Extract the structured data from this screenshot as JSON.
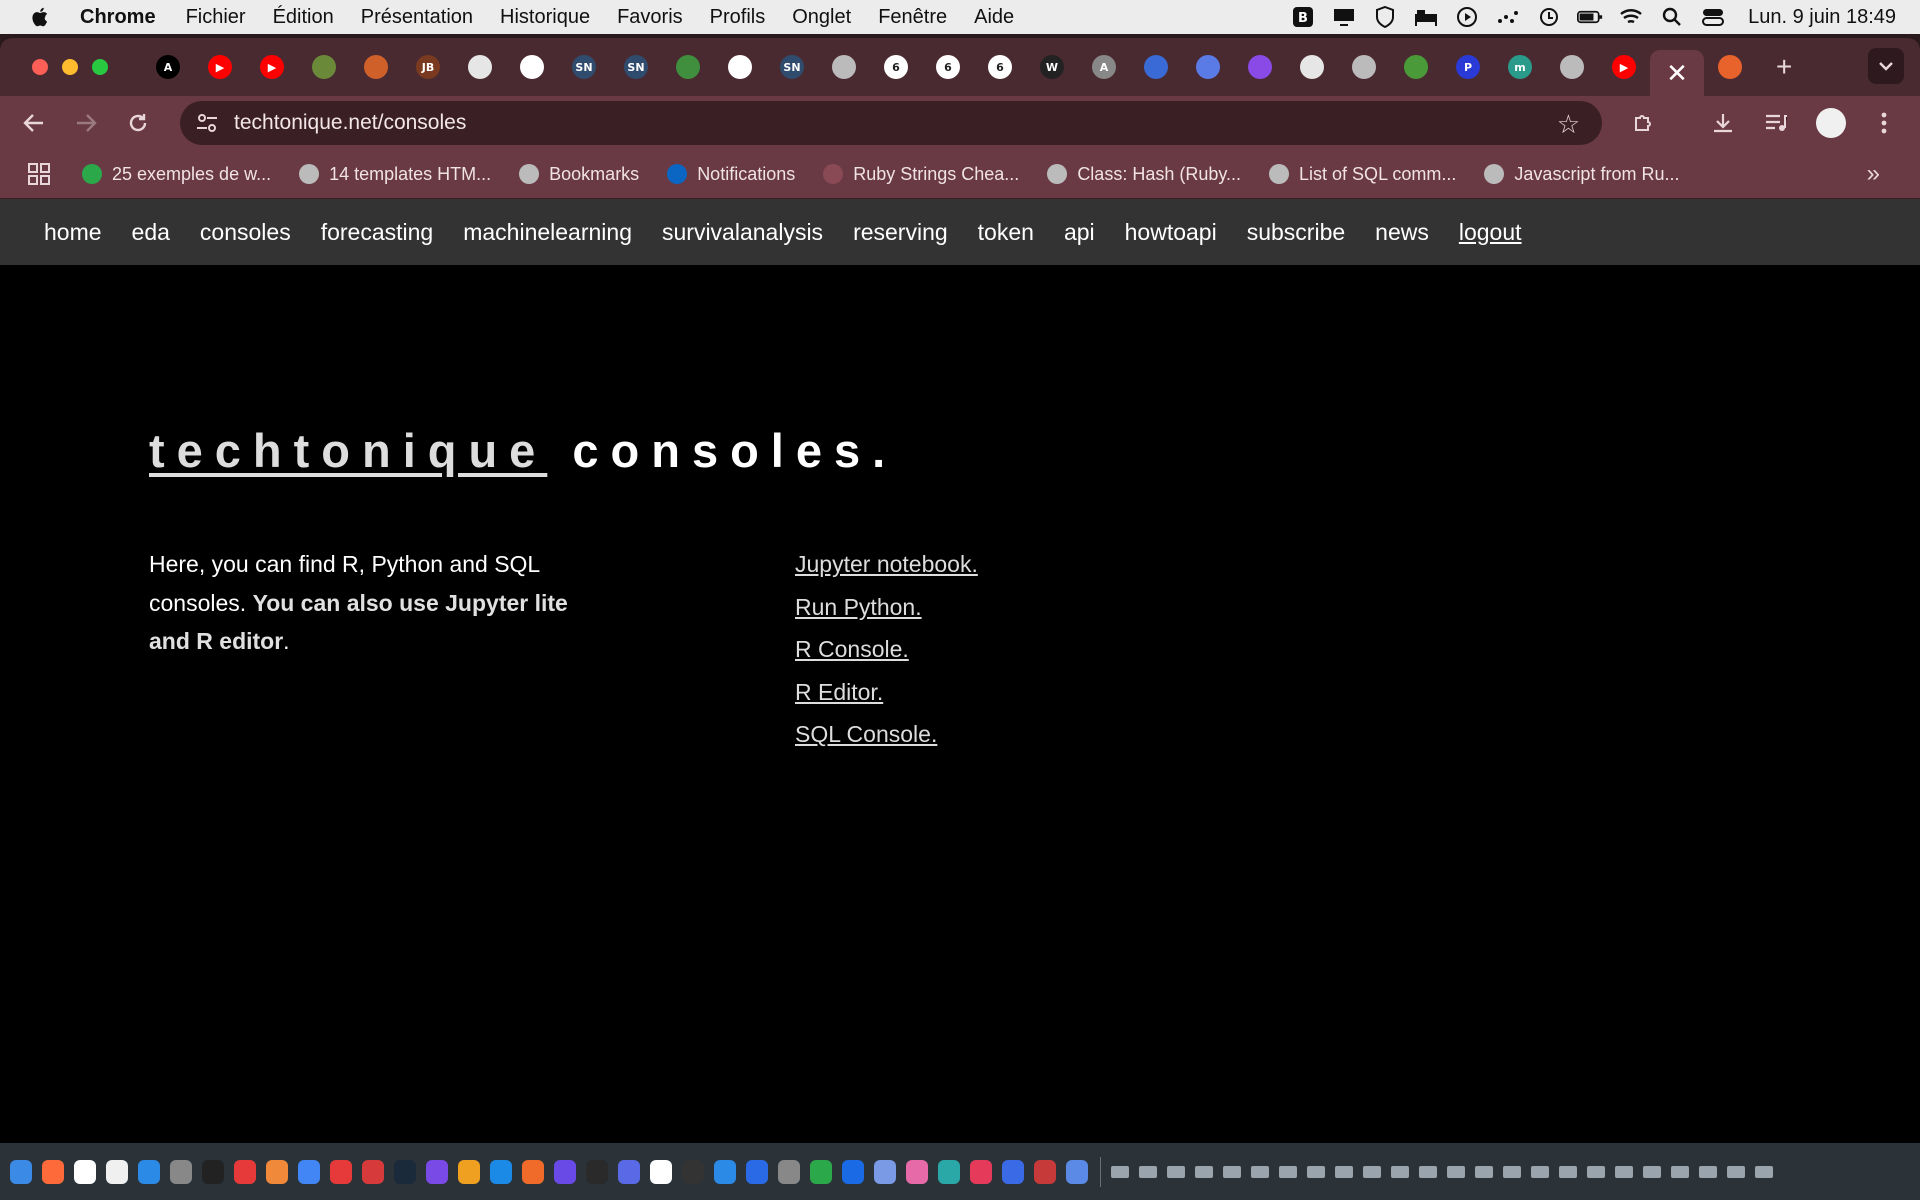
{
  "menubar": {
    "app": "Chrome",
    "items": [
      "Fichier",
      "Édition",
      "Présentation",
      "Historique",
      "Favoris",
      "Profils",
      "Onglet",
      "Fenêtre",
      "Aide"
    ],
    "clock": "Lun. 9 juin  18:49"
  },
  "tabs": {
    "favicons": [
      {
        "letter": "A",
        "color": "#000000"
      },
      {
        "letter": "▶",
        "color": "#ff0000"
      },
      {
        "letter": "▶",
        "color": "#ff0000"
      },
      {
        "letter": "",
        "color": "#6a8a3a"
      },
      {
        "letter": "",
        "color": "#d0602a"
      },
      {
        "letter": "JB",
        "color": "#7a3a20"
      },
      {
        "letter": "",
        "color": "#e6e6e6"
      },
      {
        "letter": "",
        "color": "#ffffff"
      },
      {
        "letter": "SN",
        "color": "#2f4b6e"
      },
      {
        "letter": "SN",
        "color": "#2f4b6e"
      },
      {
        "letter": "",
        "color": "#3f8f3f"
      },
      {
        "letter": "",
        "color": "#ffffff"
      },
      {
        "letter": "SN",
        "color": "#2f4b6e"
      },
      {
        "letter": "",
        "color": "#bbbbbb"
      },
      {
        "letter": "6",
        "color": "#ffffff"
      },
      {
        "letter": "6",
        "color": "#ffffff"
      },
      {
        "letter": "6",
        "color": "#ffffff"
      },
      {
        "letter": "W",
        "color": "#222222"
      },
      {
        "letter": "A",
        "color": "#888888"
      },
      {
        "letter": "",
        "color": "#3a6ad6"
      },
      {
        "letter": "",
        "color": "#5a7ae6"
      },
      {
        "letter": "",
        "color": "#8a4ae6"
      },
      {
        "letter": "",
        "color": "#e6e6e6"
      },
      {
        "letter": "",
        "color": "#bbbbbb"
      },
      {
        "letter": "",
        "color": "#4a9a3a"
      },
      {
        "letter": "P",
        "color": "#2a3ad6"
      },
      {
        "letter": "m",
        "color": "#2a9a8a"
      },
      {
        "letter": "",
        "color": "#bbbbbb"
      },
      {
        "letter": "▶",
        "color": "#ff0000"
      }
    ],
    "active_close": "✕",
    "after_active": {
      "letter": "",
      "color": "#e8632b"
    },
    "new_tab": "+"
  },
  "toolbar": {
    "url": "techtonique.net/consoles"
  },
  "bookmarks": [
    {
      "label": "25 exemples de w...",
      "color": "#2aa84a"
    },
    {
      "label": "14 templates HTM...",
      "color": "#bbbbbb"
    },
    {
      "label": "Bookmarks",
      "color": "#bbbbbb"
    },
    {
      "label": "Notifications",
      "color": "#0a66c2"
    },
    {
      "label": "Ruby Strings Chea...",
      "color": "#8a4a55"
    },
    {
      "label": "Class: Hash (Ruby...",
      "color": "#bbbbbb"
    },
    {
      "label": "List of SQL comm...",
      "color": "#bbbbbb"
    },
    {
      "label": "Javascript from Ru...",
      "color": "#bbbbbb"
    }
  ],
  "site": {
    "nav": [
      "home",
      "eda",
      "consoles",
      "forecasting",
      "machinelearning",
      "survivalanalysis",
      "reserving",
      "token",
      "api",
      "howtoapi",
      "subscribe",
      "news"
    ],
    "logout": "logout",
    "title_brand": "techtonique",
    "title_rest": " consoles.",
    "intro_plain": "Here, you can find R, Python and SQL consoles.",
    "intro_bold": "You can also use Jupyter lite and R editor",
    "intro_end": ".",
    "links": [
      "Jupyter notebook.",
      "Run Python.",
      "R Console.",
      "R Editor.",
      "SQL Console."
    ]
  },
  "dock": {
    "colors": [
      "#3a8ae6",
      "#ff6a3a",
      "#ffffff",
      "#f0f0f0",
      "#2a8ae6",
      "#888888",
      "#222222",
      "#e63a3a",
      "#f08a3a",
      "#4285f4",
      "#e63a3a",
      "#d63a3a",
      "#1a2a3a",
      "#7a4ae6",
      "#f0a020",
      "#1a8ae6",
      "#f06a2a",
      "#6a4ae6",
      "#2a2a2a",
      "#5a6ae6",
      "#ffffff",
      "#333333",
      "#2a8ae6",
      "#2a6ae6",
      "#888888",
      "#2aa84a",
      "#1a6ae6",
      "#7a9ae6",
      "#e66aa8",
      "#2aa8a8",
      "#e63a5a",
      "#3a6ae6",
      "#c63a3a",
      "#5a8ae6"
    ]
  }
}
